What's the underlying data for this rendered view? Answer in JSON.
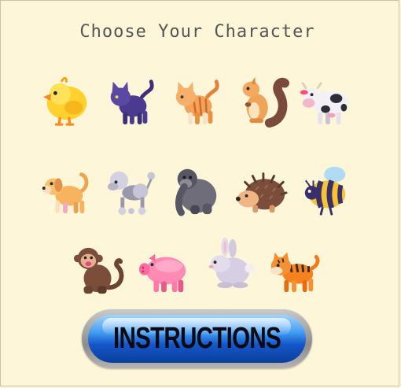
{
  "screen": {
    "title": "Choose Your Character"
  },
  "characters": [
    {
      "name": "chick",
      "icon": "chick-icon"
    },
    {
      "name": "cat",
      "icon": "cat-icon"
    },
    {
      "name": "tabby-cat",
      "icon": "tabby-cat-icon"
    },
    {
      "name": "squirrel",
      "icon": "squirrel-icon"
    },
    {
      "name": "cow",
      "icon": "cow-icon"
    },
    {
      "name": "dog",
      "icon": "dog-icon"
    },
    {
      "name": "poodle",
      "icon": "poodle-icon"
    },
    {
      "name": "gorilla",
      "icon": "gorilla-icon"
    },
    {
      "name": "hedgehog",
      "icon": "hedgehog-icon"
    },
    {
      "name": "bee",
      "icon": "bee-icon"
    },
    {
      "name": "monkey",
      "icon": "monkey-icon"
    },
    {
      "name": "pig",
      "icon": "pig-icon"
    },
    {
      "name": "rabbit",
      "icon": "rabbit-icon"
    },
    {
      "name": "tiger",
      "icon": "tiger-icon"
    }
  ],
  "instructions_button": {
    "label": "INSTRUCTIONS"
  },
  "colors": {
    "background": "#fdf6d8",
    "button_blue": "#1456c9",
    "button_frame": "#9a9a9a"
  }
}
